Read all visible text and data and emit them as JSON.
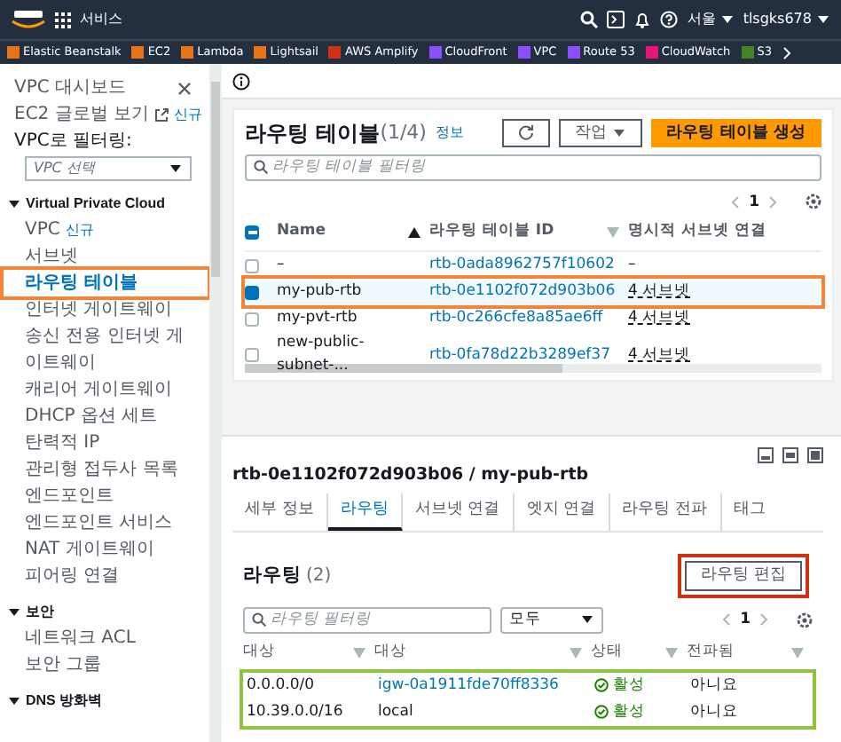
{
  "top_bar": {
    "services": "서비스",
    "region": "서울",
    "account": "tlsgks678"
  },
  "favorites": [
    {
      "label": "Elastic Beanstalk",
      "color": "#e7731b"
    },
    {
      "label": "EC2",
      "color": "#e7731b"
    },
    {
      "label": "Lambda",
      "color": "#e7731b"
    },
    {
      "label": "Lightsail",
      "color": "#e7731b"
    },
    {
      "label": "AWS Amplify",
      "color": "#d13212"
    },
    {
      "label": "CloudFront",
      "color": "#8c4fff"
    },
    {
      "label": "VPC",
      "color": "#8c4fff"
    },
    {
      "label": "Route 53",
      "color": "#8c4fff"
    },
    {
      "label": "CloudWatch",
      "color": "#e7157b"
    },
    {
      "label": "S3",
      "color": "#3f8624"
    }
  ],
  "sidebar": [
    {
      "kind": "link",
      "label": "VPC 대시보드"
    },
    {
      "kind": "external",
      "label": "EC2 글로벌 보기",
      "badge": "신규"
    },
    {
      "kind": "label",
      "label": "VPC로 필터링:"
    },
    {
      "kind": "select",
      "placeholder": "VPC 선택"
    },
    {
      "kind": "section",
      "label": "Virtual Private Cloud",
      "expanded": true
    },
    {
      "kind": "link",
      "label": "VPC",
      "badge": "신규"
    },
    {
      "kind": "link",
      "label": "서브넷"
    },
    {
      "kind": "link",
      "label": "라우팅 테이블",
      "selected": true,
      "highlighted": true
    },
    {
      "kind": "link",
      "label": "인터넷 게이트웨이"
    },
    {
      "kind": "link",
      "label": "송신 전용 인터넷 게이트웨이"
    },
    {
      "kind": "link",
      "label": "캐리어 게이트웨이"
    },
    {
      "kind": "link",
      "label": "DHCP 옵션 세트"
    },
    {
      "kind": "link",
      "label": "탄력적 IP"
    },
    {
      "kind": "link",
      "label": "관리형 접두사 목록"
    },
    {
      "kind": "link",
      "label": "엔드포인트"
    },
    {
      "kind": "link",
      "label": "엔드포인트 서비스"
    },
    {
      "kind": "link",
      "label": "NAT 게이트웨이"
    },
    {
      "kind": "link",
      "label": "피어링 연결"
    },
    {
      "kind": "section",
      "label": "보안",
      "expanded": true
    },
    {
      "kind": "link",
      "label": "네트워크 ACL"
    },
    {
      "kind": "link",
      "label": "보안 그룹"
    },
    {
      "kind": "section",
      "label": "DNS 방화벽",
      "expanded": true
    }
  ],
  "tables_panel": {
    "select_all_partial": true,
    "title": "라우팅 테이블",
    "count": "(1/4)",
    "info": "정보",
    "actions": "작업",
    "create": "라우팅 테이블 생성",
    "search": {
      "placeholder": "라우팅 테이블 필터링"
    },
    "page": "1",
    "columns": [
      "Name",
      "라우팅 테이블 ID",
      "명시적 서브넷 연결"
    ],
    "rows": [
      {
        "selected": false,
        "highlighted": false,
        "name": "–",
        "id": "rtb-0ada8962757f10602",
        "subnets": "–"
      },
      {
        "selected": true,
        "highlighted": true,
        "name": "my-pub-rtb",
        "id": "rtb-0e1102f072d903b06",
        "subnets": "4 서브넷"
      },
      {
        "selected": false,
        "highlighted": false,
        "name": "my-pvt-rtb",
        "id": "rtb-0c266cfe8a85ae6ff",
        "subnets": "4 서브넷"
      },
      {
        "selected": false,
        "highlighted": false,
        "name": "new-public-subnet-...",
        "id": "rtb-0fa78d22b3289ef37",
        "subnets": "4 서브넷"
      }
    ]
  },
  "detail": {
    "title": "rtb-0e1102f072d903b06 / my-pub-rtb",
    "tabs": [
      {
        "label": "세부 정보",
        "selected": false
      },
      {
        "label": "라우팅",
        "selected": true
      },
      {
        "label": "서브넷 연결",
        "selected": false
      },
      {
        "label": "엣지 연결",
        "selected": false
      },
      {
        "label": "라우팅 전파",
        "selected": false
      },
      {
        "label": "태그",
        "selected": false
      }
    ],
    "routes_title": "라우팅",
    "routes_count": "(2)",
    "edit": {
      "label": "라우팅 편집",
      "highlighted": true
    },
    "search": {
      "placeholder": "라우팅 필터링"
    },
    "filter": "모두",
    "page": "1",
    "columns": [
      "대상",
      "대상",
      "상태",
      "전파됨"
    ],
    "rows_highlighted": true,
    "rows": [
      {
        "destination": "0.0.0.0/0",
        "target": "igw-0a1911fde70ff8336",
        "target_link": true,
        "status": "활성",
        "propagated": "아니요"
      },
      {
        "destination": "10.39.0.0/16",
        "target": "local",
        "target_link": false,
        "status": "활성",
        "propagated": "아니요"
      }
    ]
  }
}
